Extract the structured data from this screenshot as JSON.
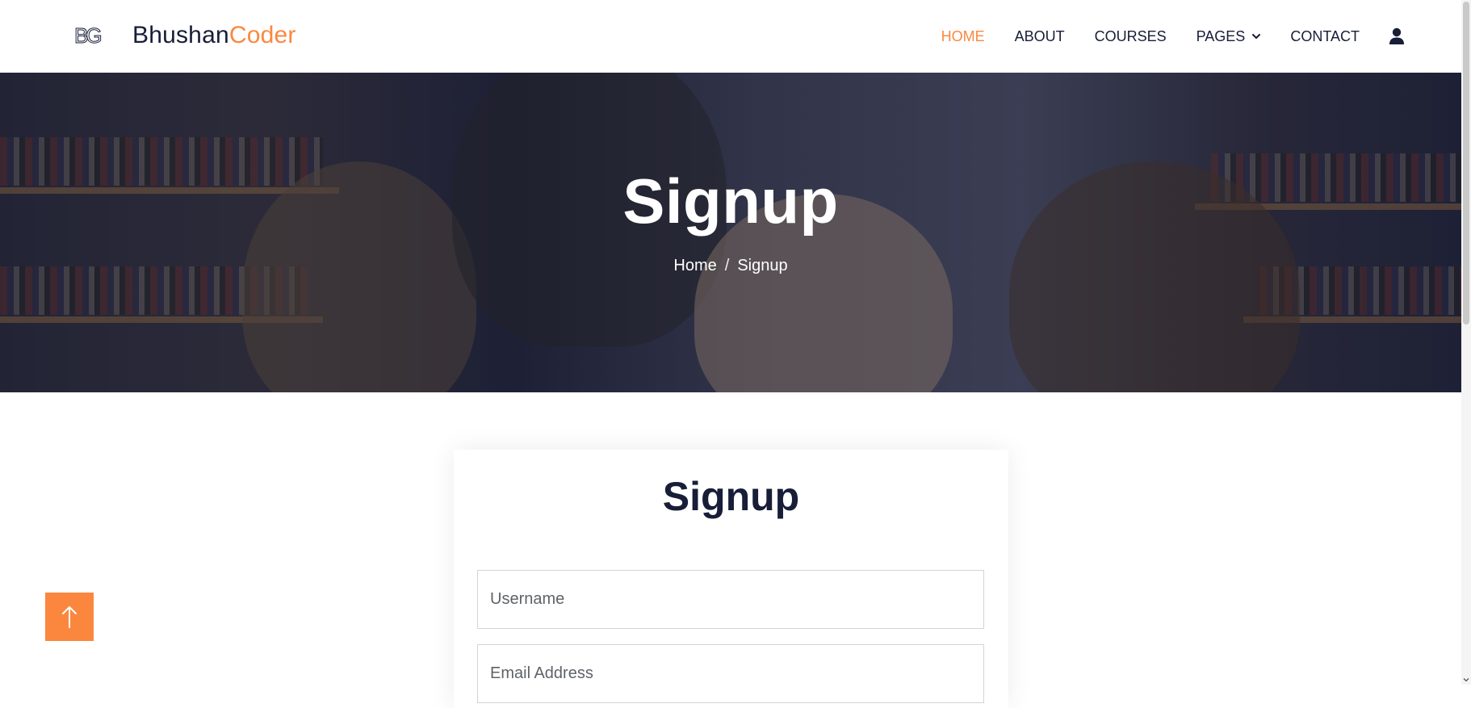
{
  "brand": {
    "logo_text": "BG",
    "name_primary": "Bhushan",
    "name_accent": "Coder"
  },
  "nav": {
    "items": [
      {
        "label": "HOME",
        "active": true
      },
      {
        "label": "ABOUT",
        "active": false
      },
      {
        "label": "COURSES",
        "active": false
      },
      {
        "label": "PAGES",
        "active": false,
        "dropdown": true
      },
      {
        "label": "CONTACT",
        "active": false
      }
    ],
    "user_icon": "user-icon"
  },
  "hero": {
    "title": "Signup",
    "breadcrumb": {
      "home": "Home",
      "separator": "/",
      "current": "Signup"
    }
  },
  "form": {
    "title": "Signup",
    "username_placeholder": "Username",
    "email_placeholder": "Email Address"
  },
  "back_to_top": {
    "icon": "arrow-up-icon"
  },
  "colors": {
    "accent": "#fb873f",
    "dark": "#181d38",
    "overlay": "rgba(24,29,56,0.70)"
  }
}
